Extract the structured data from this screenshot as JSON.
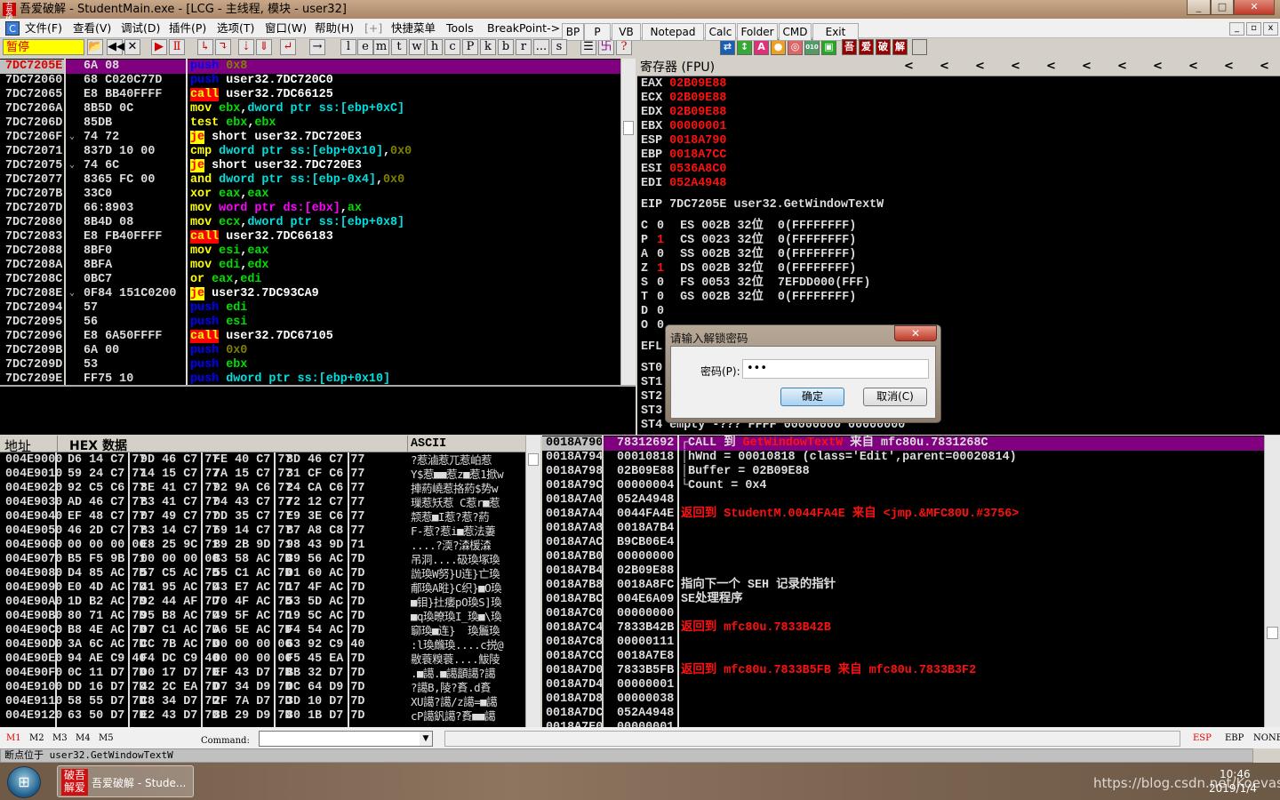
{
  "window": {
    "title": "吾爱破解 - StudentMain.exe - [LCG - 主线程, 模块 - user32]",
    "minimize": "_",
    "maximize": "□",
    "close": "✕"
  },
  "menu": {
    "app_icon": "C",
    "items": [
      "文件(F)",
      "查看(V)",
      "调试(D)",
      "插件(P)",
      "选项(T)",
      "窗口(W)",
      "帮助(H)",
      "[+]",
      "快捷菜单",
      "Tools",
      "BreakPoint->"
    ],
    "float_buttons": [
      "BP",
      "P",
      "VB",
      "Notepad",
      "Calc",
      "Folder",
      "CMD",
      "Exit"
    ]
  },
  "toolbar": {
    "status": "暂停",
    "letters": [
      "l",
      "e",
      "m",
      "t",
      "w",
      "h",
      "c",
      "P",
      "k",
      "b",
      "r",
      "...",
      "s"
    ],
    "help": "?",
    "brand_chars": [
      "吾",
      "爱",
      "破",
      "解"
    ]
  },
  "disasm": {
    "rows": [
      {
        "addr": "7DC7205E",
        "hex": "6A 08",
        "segs": [
          [
            "push",
            "push"
          ],
          [
            " "
          ],
          [
            "0x8",
            "imm"
          ]
        ]
      },
      {
        "addr": "7DC72060",
        "hex": "68 C020C77D",
        "segs": [
          [
            "push",
            "push"
          ],
          [
            " "
          ],
          [
            "user32.7DC720C0",
            "txt"
          ]
        ]
      },
      {
        "addr": "7DC72065",
        "hex": "E8 BB40FFFF",
        "segs": [
          [
            "call",
            "call"
          ],
          [
            " "
          ],
          [
            "user32.7DC66125",
            "txt"
          ]
        ]
      },
      {
        "addr": "7DC7206A",
        "hex": "8B5D 0C",
        "segs": [
          [
            "mov",
            "op"
          ],
          [
            " "
          ],
          [
            "ebx",
            "reg"
          ],
          [
            ",",
            "txt"
          ],
          [
            "dword ptr ss:[ebp+0xC]",
            "mem"
          ]
        ]
      },
      {
        "addr": "7DC7206D",
        "hex": "85DB",
        "segs": [
          [
            "test",
            "op"
          ],
          [
            " "
          ],
          [
            "ebx",
            "reg"
          ],
          [
            ",",
            "txt"
          ],
          [
            "ebx",
            "reg"
          ]
        ]
      },
      {
        "addr": "7DC7206F",
        "jump": "⌄",
        "hex": "74 72",
        "segs": [
          [
            "je",
            "jcc"
          ],
          [
            " "
          ],
          [
            "short user32.7DC720E3",
            "txt"
          ]
        ]
      },
      {
        "addr": "7DC72071",
        "hex": "837D 10 00",
        "segs": [
          [
            "cmp",
            "op"
          ],
          [
            " "
          ],
          [
            "dword ptr ss:[ebp+0x10]",
            "mem"
          ],
          [
            ",",
            "txt"
          ],
          [
            "0x0",
            "imm"
          ]
        ]
      },
      {
        "addr": "7DC72075",
        "jump": "⌄",
        "hex": "74 6C",
        "segs": [
          [
            "je",
            "jcc"
          ],
          [
            " "
          ],
          [
            "short user32.7DC720E3",
            "txt"
          ]
        ]
      },
      {
        "addr": "7DC72077",
        "hex": "8365 FC 00",
        "segs": [
          [
            "and",
            "op"
          ],
          [
            " "
          ],
          [
            "dword ptr ss:[ebp-0x4]",
            "mem"
          ],
          [
            ",",
            "txt"
          ],
          [
            "0x0",
            "imm"
          ]
        ]
      },
      {
        "addr": "7DC7207B",
        "hex": "33C0",
        "segs": [
          [
            "xor",
            "op"
          ],
          [
            " "
          ],
          [
            "eax",
            "reg"
          ],
          [
            ",",
            "txt"
          ],
          [
            "eax",
            "reg"
          ]
        ]
      },
      {
        "addr": "7DC7207D",
        "hex": "66:8903",
        "segs": [
          [
            "mov",
            "op"
          ],
          [
            " "
          ],
          [
            "word ptr ds:[ebx]",
            "memw"
          ],
          [
            ",",
            "txt"
          ],
          [
            "ax",
            "reg"
          ]
        ]
      },
      {
        "addr": "7DC72080",
        "hex": "8B4D 08",
        "segs": [
          [
            "mov",
            "op"
          ],
          [
            " "
          ],
          [
            "ecx",
            "reg"
          ],
          [
            ",",
            "txt"
          ],
          [
            "dword ptr ss:[ebp+0x8]",
            "mem"
          ]
        ]
      },
      {
        "addr": "7DC72083",
        "hex": "E8 FB40FFFF",
        "segs": [
          [
            "call",
            "call"
          ],
          [
            " "
          ],
          [
            "user32.7DC66183",
            "txt"
          ]
        ]
      },
      {
        "addr": "7DC72088",
        "hex": "8BF0",
        "segs": [
          [
            "mov",
            "op"
          ],
          [
            " "
          ],
          [
            "esi",
            "reg"
          ],
          [
            ",",
            "txt"
          ],
          [
            "eax",
            "reg"
          ]
        ]
      },
      {
        "addr": "7DC7208A",
        "hex": "8BFA",
        "segs": [
          [
            "mov",
            "op"
          ],
          [
            " "
          ],
          [
            "edi",
            "reg"
          ],
          [
            ",",
            "txt"
          ],
          [
            "edx",
            "reg"
          ]
        ]
      },
      {
        "addr": "7DC7208C",
        "hex": "0BC7",
        "segs": [
          [
            "or",
            "op"
          ],
          [
            " "
          ],
          [
            "eax",
            "reg"
          ],
          [
            ",",
            "txt"
          ],
          [
            "edi",
            "reg"
          ]
        ]
      },
      {
        "addr": "7DC7208E",
        "jump": "⌄",
        "hex": "0F84 151C0200",
        "segs": [
          [
            "je",
            "jcc"
          ],
          [
            " "
          ],
          [
            "user32.7DC93CA9",
            "txt"
          ]
        ]
      },
      {
        "addr": "7DC72094",
        "hex": "57",
        "segs": [
          [
            "push",
            "push"
          ],
          [
            " "
          ],
          [
            "edi",
            "reg"
          ]
        ]
      },
      {
        "addr": "7DC72095",
        "hex": "56",
        "segs": [
          [
            "push",
            "push"
          ],
          [
            " "
          ],
          [
            "esi",
            "reg"
          ]
        ]
      },
      {
        "addr": "7DC72096",
        "hex": "E8 6A50FFFF",
        "segs": [
          [
            "call",
            "call"
          ],
          [
            " "
          ],
          [
            "user32.7DC67105",
            "txt"
          ]
        ]
      },
      {
        "addr": "7DC7209B",
        "hex": "6A 00",
        "segs": [
          [
            "push",
            "push"
          ],
          [
            " "
          ],
          [
            "0x0",
            "imm"
          ]
        ]
      },
      {
        "addr": "7DC7209D",
        "hex": "53",
        "segs": [
          [
            "push",
            "push"
          ],
          [
            " "
          ],
          [
            "ebx",
            "reg"
          ]
        ]
      },
      {
        "addr": "7DC7209E",
        "hex": "FF75 10",
        "segs": [
          [
            "push",
            "push"
          ],
          [
            " "
          ],
          [
            "dword ptr ss:[ebp+0x10]",
            "mem"
          ]
        ]
      }
    ]
  },
  "registers": {
    "title": "寄存器 (FPU)",
    "arrow": "<",
    "gp": [
      [
        "EAX",
        "02B09E88"
      ],
      [
        "ECX",
        "02B09E88"
      ],
      [
        "EDX",
        "02B09E88"
      ],
      [
        "EBX",
        "00000001"
      ],
      [
        "ESP",
        "0018A790"
      ],
      [
        "EBP",
        "0018A7CC"
      ],
      [
        "ESI",
        "0536A8C0"
      ],
      [
        "EDI",
        "052A4948"
      ]
    ],
    "eip": "EIP 7DC7205E user32.GetWindowTextW",
    "flags": [
      {
        "f": "C",
        "v": "0",
        "seg": "ES 002B 32位  0(FFFFFFFF)"
      },
      {
        "f": "P",
        "v": "1",
        "seg": "CS 0023 32位  0(FFFFFFFF)",
        "changed": true
      },
      {
        "f": "A",
        "v": "0",
        "seg": "SS 002B 32位  0(FFFFFFFF)"
      },
      {
        "f": "Z",
        "v": "1",
        "seg": "DS 002B 32位  0(FFFFFFFF)",
        "changed": true
      },
      {
        "f": "S",
        "v": "0",
        "seg": "FS 0053 32位  7EFDD000(FFF)"
      },
      {
        "f": "T",
        "v": "0",
        "seg": "GS 002B 32位  0(FFFFFFFF)"
      },
      {
        "f": "D",
        "v": "0",
        "seg": ""
      },
      {
        "f": "O",
        "v": "0",
        "seg": ""
      }
    ],
    "efl": "EFL",
    "fpu": [
      "ST0",
      "ST1",
      "ST2",
      "ST3",
      "ST4 empty -??? FFFF 00000000 00000000"
    ]
  },
  "dialog": {
    "title": "请输入解锁密码",
    "label": "密码(P):",
    "value": "•••",
    "ok": "确定",
    "cancel": "取消(C)",
    "close": "✕"
  },
  "dump": {
    "headers": [
      "地址",
      "HEX 数据",
      "ASCII"
    ],
    "rows": [
      [
        "004E9000",
        "D6 14 C7 77",
        "9D 46 C7 77",
        "FE 40 C7 77",
        "8D 46 C7 77",
        "?惹滷惹兀惹岶惹"
      ],
      [
        "004E9010",
        "59 24 C7 77",
        "14 15 C7 77",
        "7A 15 C7 77",
        "31 CF C6 77",
        "Y$惹■■惹z■惹1掀w"
      ],
      [
        "004E9020",
        "92 C5 C6 77",
        "8E 41 C7 77",
        "92 9A C6 77",
        "24 CA C6 77",
        "捙葯嶢惹挌葯$势w"
      ],
      [
        "004E9030",
        "AD 46 C7 77",
        "B3 41 C7 77",
        "04 43 C7 77",
        "72 12 C7 77",
        "璅惹矨惹 C惹r■惹"
      ],
      [
        "004E9040",
        "EF 48 C7 77",
        "07 49 C7 77",
        "DD 35 C7 77",
        "E9 3E C6 77",
        "颒惹■I惹?惹?葯"
      ],
      [
        "004E9050",
        "46 2D C7 77",
        "B3 14 C7 77",
        "69 14 C7 77",
        "B7 A8 C8 77",
        "F-惹?惹i■惹法萋"
      ],
      [
        "004E9060",
        "00 00 00 00",
        "E8 25 9C 71",
        "B9 2B 9D 71",
        "98 43 9D 71",
        "....?渜?潹楥潹"
      ],
      [
        "004E9070",
        "B5 F5 9B 71",
        "00 00 00 00",
        "B3 58 AC 7D",
        "89 56 AC 7D",
        "吊洞....砐瑍塚瑍"
      ],
      [
        "004E9080",
        "D4 85 AC 7D",
        "57 C5 AC 7D",
        "55 C1 AC 7D",
        "01 60 AC 7D",
        "詤瑍W努}U连}亡瑍"
      ],
      [
        "004E9090",
        "E0 4D AC 7D",
        "41 95 AC 7D",
        "43 E7 AC 7D",
        "17 4F AC 7D",
        "郙瑍A暀}C织}■O瑍"
      ],
      [
        "004E90A0",
        "1D B2 AC 7D",
        "92 44 AF 7D",
        "70 4F AC 7D",
        "53 5D AC 7D",
        "■钼}扗痿pO瑍S]瑍"
      ],
      [
        "004E90B0",
        "80 71 AC 7D",
        "95 B8 AC 7D",
        "49 5F AC 7D",
        "19 5C AC 7D",
        "■q瑍暸瑍I_瑍■\\瑍"
      ],
      [
        "004E90C0",
        "B8 4E AC 7D",
        "07 C1 AC 7D",
        "A6 5E AC 7D",
        "F4 54 AC 7D",
        "窷瑍■连}  瑍鬞瑍"
      ],
      [
        "004E90D0",
        "3A 6C AC 7D",
        "CC 7B AC 7D",
        "00 00 00 00",
        "63 92 C9 40",
        ":l瑍虪瑍....c捝@"
      ],
      [
        "004E90E0",
        "94 AE C9 40",
        "F4 DC C9 40",
        "00 00 00 00",
        "F5 45 EA 7D",
        "敭蓑糗蓑....鮁陵"
      ],
      [
        "004E90F0",
        "0C 11 D7 7D",
        "00 17 D7 7D",
        "EF 43 D7 7D",
        "BB 32 D7 7D",
        ".■譪.■譪顲譪?譪"
      ],
      [
        "004E9100",
        "DD 16 D7 7D",
        "42 2C EA 7D",
        "D7 34 D9 7D",
        "0C 64 D9 7D",
        "?譪B,陵?賌.d賌"
      ],
      [
        "004E9110",
        "58 55 D7 7D",
        "C8 34 D7 7D",
        "2F 7A D7 7D",
        "3D 10 D7 7D",
        "XU譪?譪/z譪=■譪"
      ],
      [
        "004E9120",
        "63 50 D7 7D",
        "E2 43 D7 7D",
        "8B 29 D9 7D",
        "80 1B D7 7D",
        "cP譪釩譪?賌■■譪"
      ]
    ]
  },
  "stack": {
    "rows": [
      {
        "addr": "0018A790",
        "val": "78312692",
        "cmt": [
          [
            "┌CALL 到 ",
            "w"
          ],
          [
            "GetWindowTextW",
            "r"
          ],
          [
            " 来自 mfc80u.7831268C",
            "w"
          ]
        ]
      },
      {
        "addr": "0018A794",
        "val": "00010818",
        "cmt": [
          [
            "│hWnd = 00010818 (class='Edit',parent=00020814)",
            "w"
          ]
        ]
      },
      {
        "addr": "0018A798",
        "val": "02B09E88",
        "cmt": [
          [
            "│Buffer = 02B09E88",
            "w"
          ]
        ]
      },
      {
        "addr": "0018A79C",
        "val": "00000004",
        "cmt": [
          [
            "└Count = 0x4",
            "w"
          ]
        ]
      },
      {
        "addr": "0018A7A0",
        "val": "052A4948",
        "cmt": []
      },
      {
        "addr": "0018A7A4",
        "val": "0044FA4E",
        "cmt": [
          [
            "返回到 StudentM.0044FA4E 来自 <jmp.&MFC80U.#3756>",
            "r"
          ]
        ]
      },
      {
        "addr": "0018A7A8",
        "val": "0018A7B4",
        "cmt": []
      },
      {
        "addr": "0018A7AC",
        "val": "B9CB06E4",
        "cmt": []
      },
      {
        "addr": "0018A7B0",
        "val": "00000000",
        "cmt": []
      },
      {
        "addr": "0018A7B4",
        "val": "02B09E88",
        "cmt": []
      },
      {
        "addr": "0018A7B8",
        "val": "0018A8FC",
        "cmt": [
          [
            "指向下一个 SEH 记录的指针",
            "w"
          ]
        ]
      },
      {
        "addr": "0018A7BC",
        "val": "004E6A09",
        "cmt": [
          [
            "SE处理程序",
            "w"
          ]
        ]
      },
      {
        "addr": "0018A7C0",
        "val": "00000000",
        "cmt": []
      },
      {
        "addr": "0018A7C4",
        "val": "7833B42B",
        "cmt": [
          [
            "返回到 mfc80u.7833B42B",
            "r"
          ]
        ]
      },
      {
        "addr": "0018A7C8",
        "val": "00000111",
        "cmt": []
      },
      {
        "addr": "0018A7CC",
        "val": "0018A7E8",
        "cmt": []
      },
      {
        "addr": "0018A7D0",
        "val": "7833B5FB",
        "cmt": [
          [
            "返回到 mfc80u.7833B5FB 来自 mfc80u.7833B3F2",
            "r"
          ]
        ]
      },
      {
        "addr": "0018A7D4",
        "val": "00000001",
        "cmt": []
      },
      {
        "addr": "0018A7D8",
        "val": "00000038",
        "cmt": []
      },
      {
        "addr": "0018A7DC",
        "val": "052A4948",
        "cmt": []
      },
      {
        "addr": "0018A7E0",
        "val": "00000001",
        "cmt": []
      }
    ]
  },
  "command": {
    "marks": [
      "M1",
      "M2",
      "M3",
      "M4",
      "M5"
    ],
    "label": "Command:",
    "value": "",
    "regs": [
      "ESP",
      "EBP",
      "NONE"
    ]
  },
  "status": "断点位于 user32.GetWindowTextW",
  "taskbar": {
    "task": "吾爱破解 - Stude...",
    "time": "10:46",
    "date": "2019/1/4",
    "watermark": "https://blog.csdn.net/Koevas"
  },
  "colors": {
    "selected_row": "#800080",
    "register_changed": "#ff1010",
    "pause_bg": "#ffff00"
  }
}
